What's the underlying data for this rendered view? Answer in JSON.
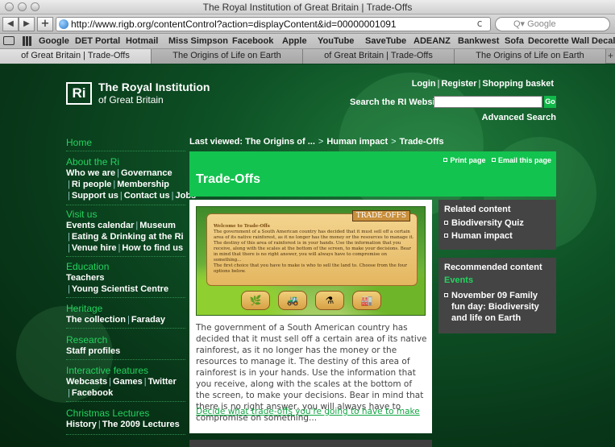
{
  "window": {
    "title": "The Royal Institution of Great Britain | Trade-Offs"
  },
  "toolbar": {
    "back": "◀",
    "forward": "▶",
    "add": "+",
    "url": "http://www.rigb.org/contentControl?action=displayContent&id=00000001091",
    "reload": "c",
    "search_placeholder": "Q▾ Google"
  },
  "bookmarks": [
    "Google",
    "DET Portal",
    "Hotmail",
    "Miss Simpson",
    "Facebook",
    "Apple",
    "YouTube",
    "SaveTube",
    "ADEANZ",
    "Bankwest",
    "Sofa",
    "Decorette Wall Decals"
  ],
  "tabs": [
    {
      "label": "of Great Britain | Trade-Offs",
      "active": true
    },
    {
      "label": "The Origins of Life on Earth",
      "active": false
    },
    {
      "label": "of Great Britain | Trade-Offs",
      "active": false
    },
    {
      "label": "The Origins of Life on Earth",
      "active": false
    }
  ],
  "tab_add": "+",
  "site": {
    "logo_mark": "Ri",
    "name_line1": "The Royal Institution",
    "name_line2": "of Great Britain",
    "login": "Login",
    "register": "Register",
    "basket": "Shopping basket",
    "search_label": "Search the RI Website",
    "go": "Go",
    "advanced_search": "Advanced Search"
  },
  "nav": {
    "home": "Home",
    "about_head": "About the Ri",
    "about_links_1": [
      "Who we are",
      "Governance"
    ],
    "about_links_2": [
      "Ri people",
      "Membership"
    ],
    "about_links_3": [
      "Support us",
      "Contact us",
      "Jobs"
    ],
    "visit_head": "Visit us",
    "visit_links_1": [
      "Events calendar",
      "Museum"
    ],
    "visit_links_2": [
      "Eating & Drinking at the Ri"
    ],
    "visit_links_3": [
      "Venue hire",
      "How to find us"
    ],
    "education_head": "Education",
    "education_links_1": [
      "Teachers"
    ],
    "education_links_2": [
      "Young Scientist Centre"
    ],
    "heritage_head": "Heritage",
    "heritage_links_1": [
      "The collection",
      "Faraday"
    ],
    "research_head": "Research",
    "research_links_1": [
      "Staff profiles"
    ],
    "interactive_head": "Interactive features",
    "interactive_links_1": [
      "Webcasts",
      "Games",
      "Twitter"
    ],
    "interactive_links_2": [
      "Facebook"
    ],
    "christmas_head": "Christmas Lectures",
    "christmas_links_1": [
      "History",
      "The 2009 Lectures"
    ]
  },
  "breadcrumb": {
    "prefix": "Last viewed:",
    "items": [
      "The Origins of ...",
      "Human impact",
      "Trade-Offs"
    ]
  },
  "page": {
    "print": "Print page",
    "email": "Email this page",
    "title": "Trade-Offs",
    "game_badge": "TRADE-OFFS",
    "game_heading": "Welcome to Trade-Offs",
    "game_body": "The government of a South American country has decided that it must sell off a certain area of its native rainforest, as it no longer has the money or the resources to manage it. The destiny of this area of rainforest is in your hands. Use the information that you receive, along with the scales at the bottom of the screen, to make your decisions. Bear in mind that there is no right answer, you will always have to compromise on something...",
    "game_choice": "The first choice that you have to make is who to sell the land to. Choose from the four options below.",
    "body": "The government of a South American country has decided that it must sell off a certain area of its native rainforest, as it no longer has the money or the resources to manage it.  The destiny of this area of rainforest is in your hands.  Use the information that you receive, along with the scales at the bottom of the screen, to make your decisions.  Bear in mind that there is no right answer, you will always have to compromise on something...",
    "link": "Decide what trade-offs you're going to have to make"
  },
  "related": {
    "heading": "Related content",
    "items": [
      "Biodiversity Quiz",
      "Human impact"
    ]
  },
  "recommended": {
    "heading": "Recommended content",
    "sub": "Events",
    "item": "November 09 Family fun day: Biodiversity and life on Earth"
  },
  "colors": {
    "accent_green": "#13c34f",
    "nav_heading_green": "#24d35f",
    "sidebar_box": "#444444"
  }
}
